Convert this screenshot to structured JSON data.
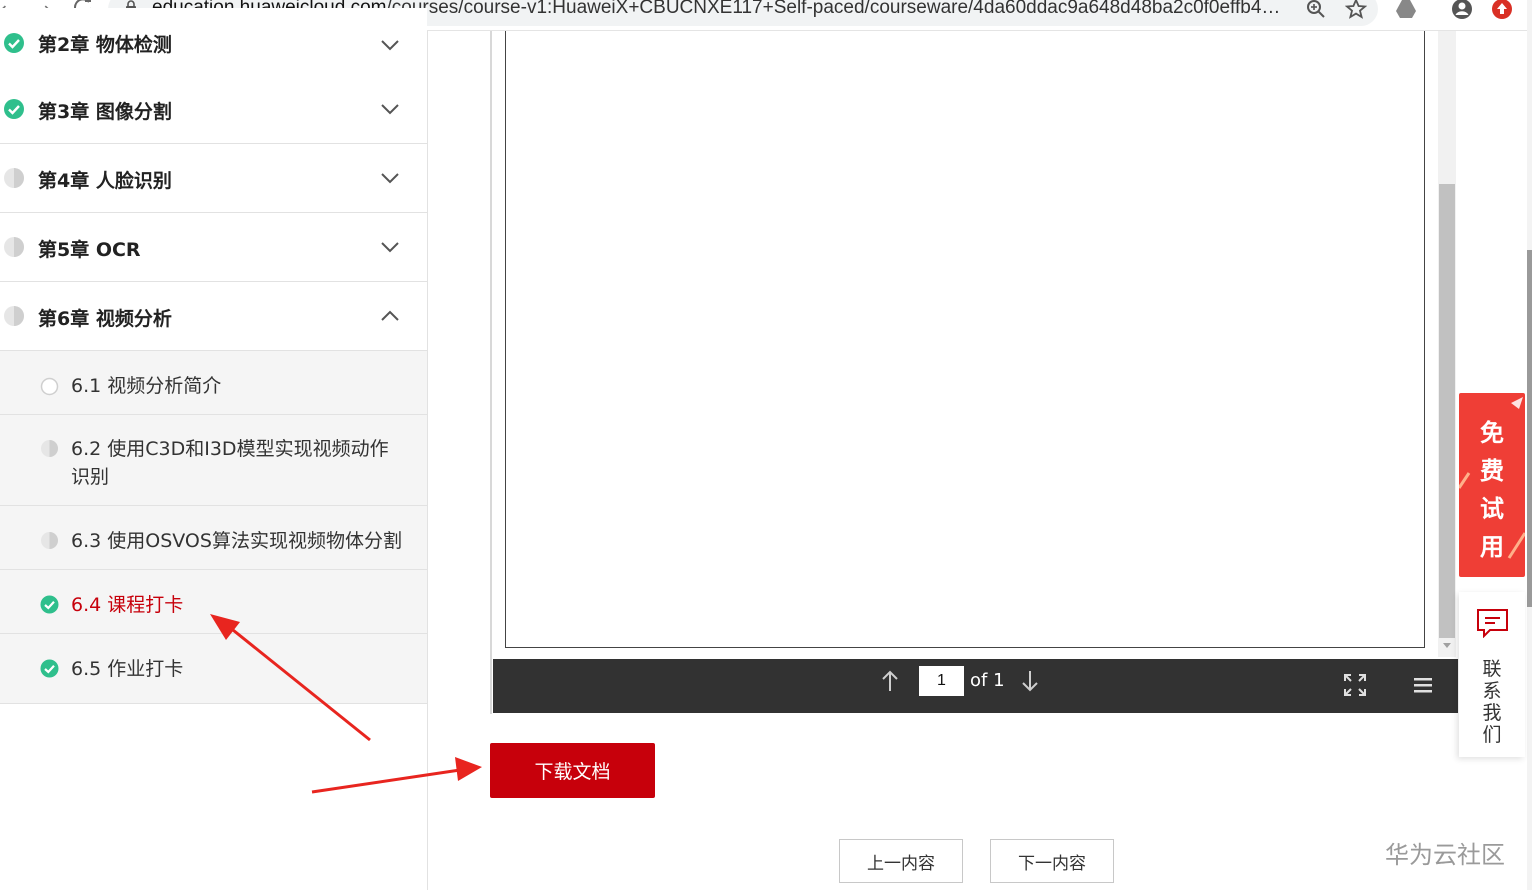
{
  "browser": {
    "url_host": "education.huaweicloud.com",
    "url_path": "/courses/course-v1:HuaweiX+CBUCNXE117+Self-paced/courseware/4da60ddac9a648d48ba2c0f0effb487..."
  },
  "sidebar": {
    "chapters": [
      {
        "title": "第2章 物体检测",
        "status": "complete",
        "expanded": false
      },
      {
        "title": "第3章 图像分割",
        "status": "complete",
        "expanded": false
      },
      {
        "title": "第4章 人脸识别",
        "status": "partial",
        "expanded": false
      },
      {
        "title": "第5章 OCR",
        "status": "partial",
        "expanded": false
      },
      {
        "title": "第6章 视频分析",
        "status": "partial",
        "expanded": true
      }
    ],
    "lessons": [
      {
        "title": "6.1 视频分析简介",
        "status": "empty"
      },
      {
        "title": "6.2 使用C3D和I3D模型实现视频动作识别",
        "status": "partial"
      },
      {
        "title": "6.3 使用OSVOS算法实现视频物体分割",
        "status": "partial"
      },
      {
        "title": "6.4 课程打卡",
        "status": "complete",
        "active": true
      },
      {
        "title": "6.5 作业打卡",
        "status": "complete"
      }
    ]
  },
  "viewer": {
    "page_value": "1",
    "page_of": "of 1"
  },
  "download_label": "下载文档",
  "prev_label": "上一内容",
  "next_label": "下一内容",
  "float": {
    "trial_chars": [
      "免",
      "费",
      "试",
      "用"
    ],
    "contact_chars": [
      "联",
      "系",
      "我",
      "们"
    ]
  },
  "watermark": "华为云社区",
  "colors": {
    "accent_red": "#c7000b",
    "complete_green": "#2fbf8c",
    "trial_red": "#ef3e36"
  }
}
